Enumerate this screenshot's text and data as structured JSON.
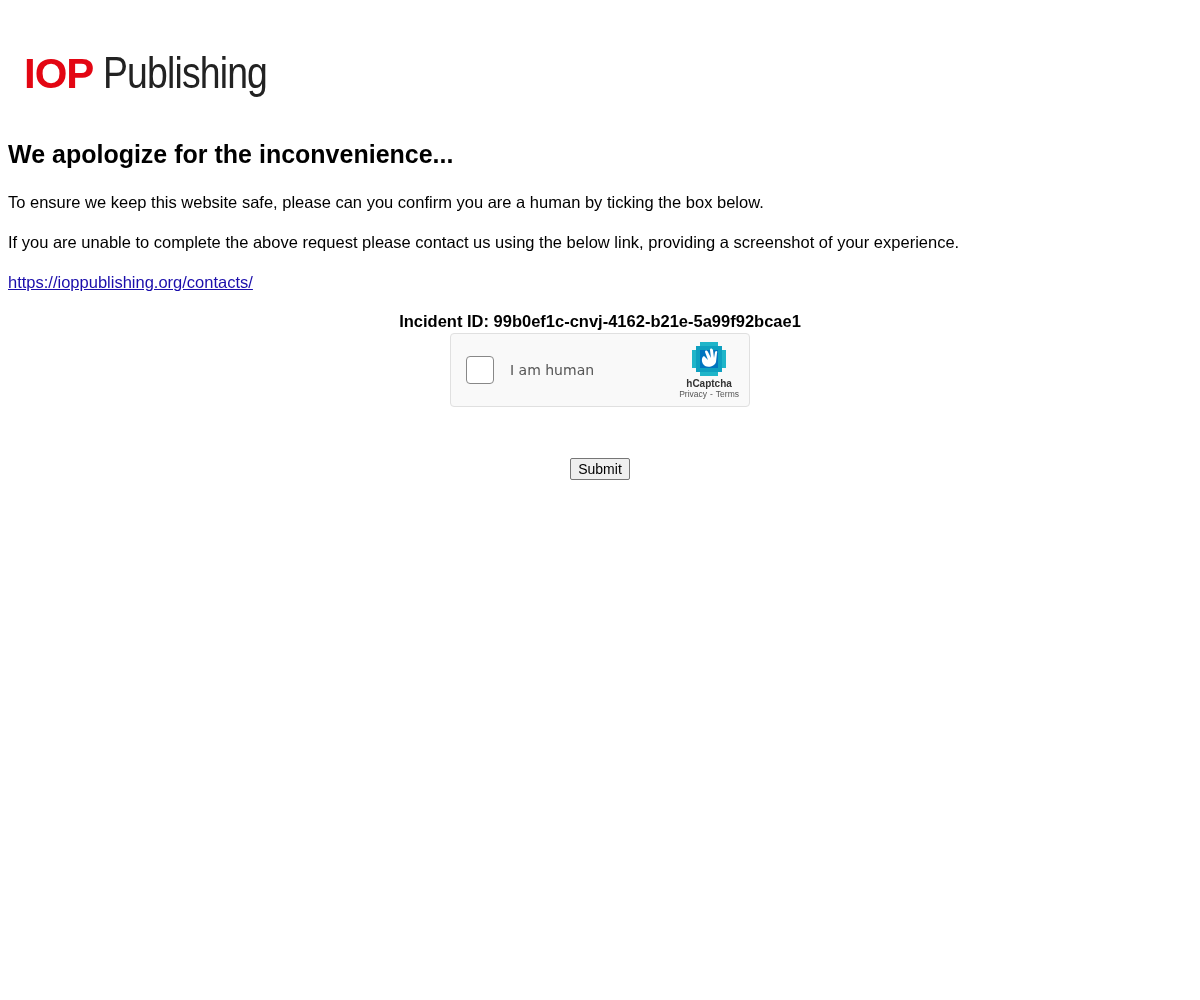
{
  "logo": {
    "mark": "IOP",
    "name": "Publishing"
  },
  "heading": "We apologize for the inconvenience...",
  "paragraphs": [
    "To ensure we keep this website safe, please can you confirm you are a human by ticking the box below.",
    "If you are unable to complete the above request please contact us using the below link, providing a screenshot of your experience."
  ],
  "contact_link": "https://ioppublishing.org/contacts/",
  "incident": "Incident ID: 99b0ef1c-cnvj-4162-b21e-5a99f92bcae1",
  "captcha": {
    "label": "I am human",
    "checked": false,
    "brand": "hCaptcha",
    "links": [
      "Privacy",
      "Terms"
    ],
    "separator": "-"
  },
  "submit": "Submit"
}
